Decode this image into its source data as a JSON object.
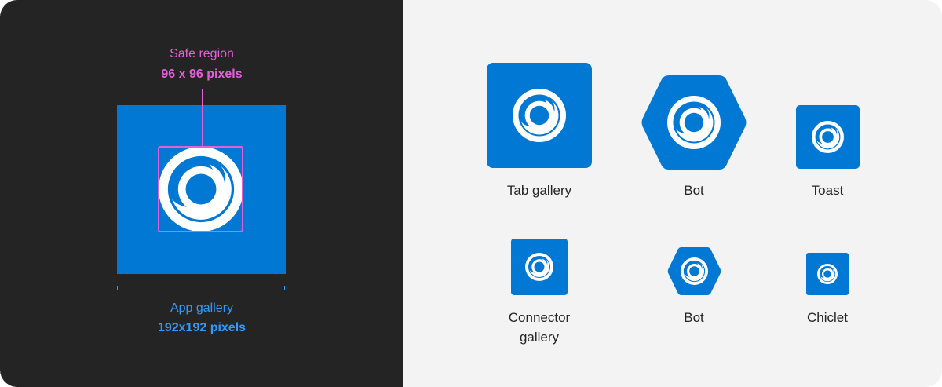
{
  "left": {
    "safe_region": {
      "title": "Safe region",
      "size": "96 x 96 pixels"
    },
    "app_gallery": {
      "title": "App gallery",
      "size": "192x192 pixels"
    }
  },
  "right": {
    "icons": [
      {
        "label": "Tab gallery",
        "shape": "rounded-square"
      },
      {
        "label": "Bot",
        "shape": "hexagon"
      },
      {
        "label": "Toast",
        "shape": "rounded-square"
      },
      {
        "label": "Connector gallery",
        "shape": "rounded-square"
      },
      {
        "label": "Bot",
        "shape": "hexagon"
      },
      {
        "label": "Chiclet",
        "shape": "rounded-square"
      }
    ]
  },
  "colors": {
    "tile_blue": "#0078d4",
    "safe_region_magenta": "#e45fd8",
    "app_gallery_blue": "#2f9bff",
    "dark_panel": "#242424",
    "light_panel": "#f3f3f3"
  }
}
